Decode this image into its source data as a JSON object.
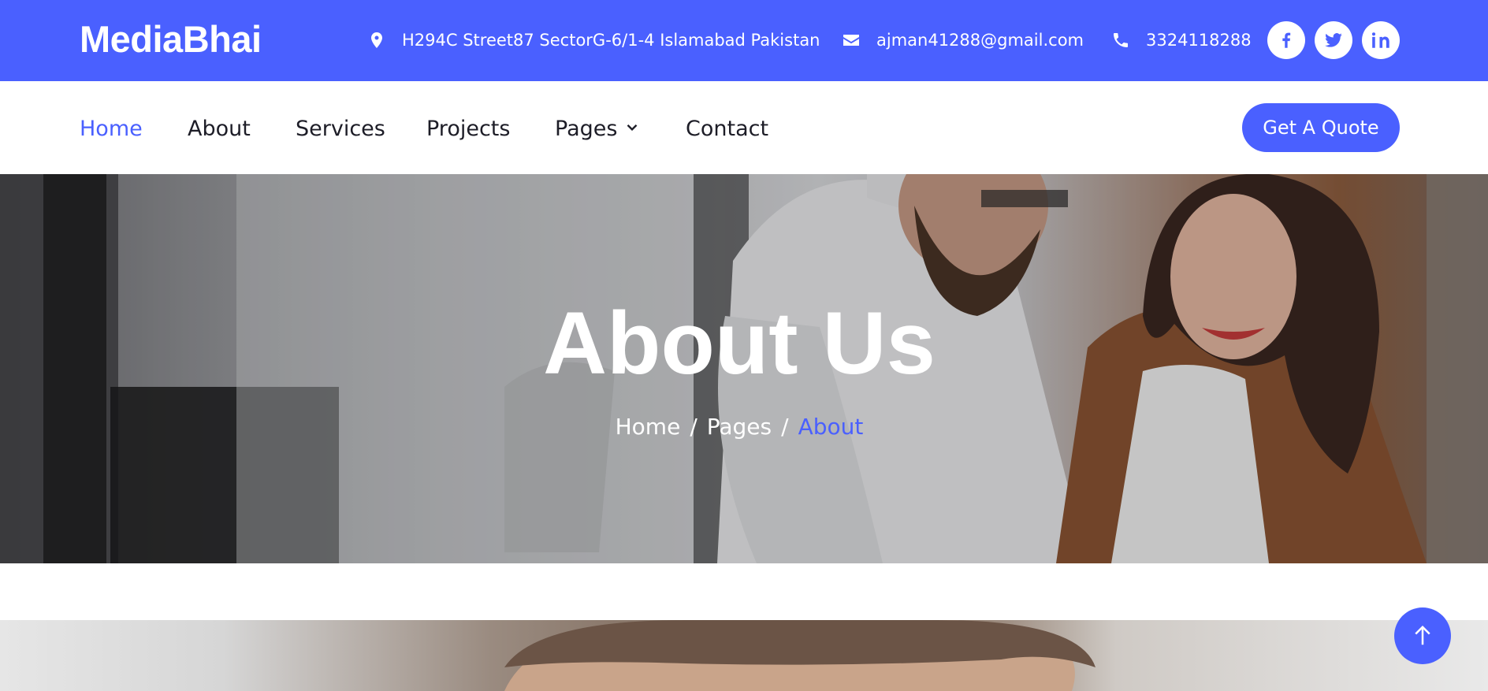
{
  "brand": "MediaBhai",
  "topbar": {
    "address": "H294C Street87 SectorG-6/1-4 Islamabad Pakistan",
    "email": "ajman41288@gmail.com",
    "phone": "3324118288",
    "social": [
      "facebook-icon",
      "twitter-icon",
      "linkedin-icon"
    ]
  },
  "nav": {
    "items": [
      {
        "label": "Home",
        "active": true
      },
      {
        "label": "About"
      },
      {
        "label": "Services"
      },
      {
        "label": "Projects"
      },
      {
        "label": "Pages",
        "dropdown": true
      },
      {
        "label": "Contact"
      }
    ],
    "cta": "Get A Quote"
  },
  "hero": {
    "title": "About Us",
    "breadcrumb": [
      {
        "label": "Home"
      },
      {
        "label": "Pages"
      },
      {
        "label": "About",
        "current": true
      }
    ],
    "separator": "/"
  },
  "colors": {
    "accent": "#4a60ff",
    "text_dark": "#1d1d27",
    "white": "#ffffff"
  }
}
